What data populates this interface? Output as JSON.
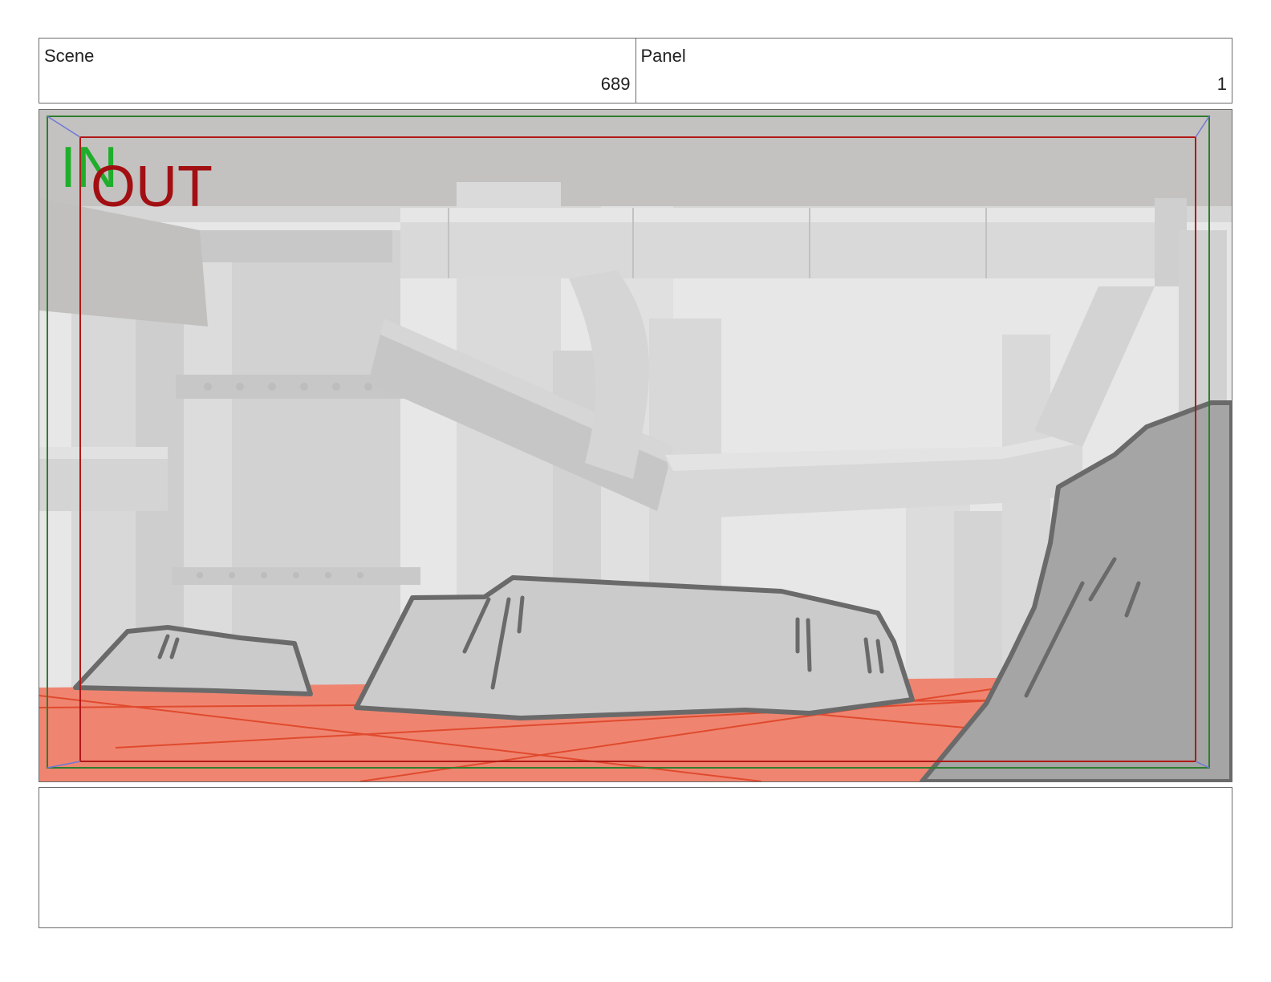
{
  "header": {
    "scene_label": "Scene",
    "scene_value": "689",
    "panel_label": "Panel",
    "panel_value": "1"
  },
  "frame_markers": {
    "in_label": "IN",
    "out_label": "OUT",
    "in_color": "#1fae2b",
    "out_color": "#a20f12"
  },
  "notes": {
    "text": ""
  }
}
